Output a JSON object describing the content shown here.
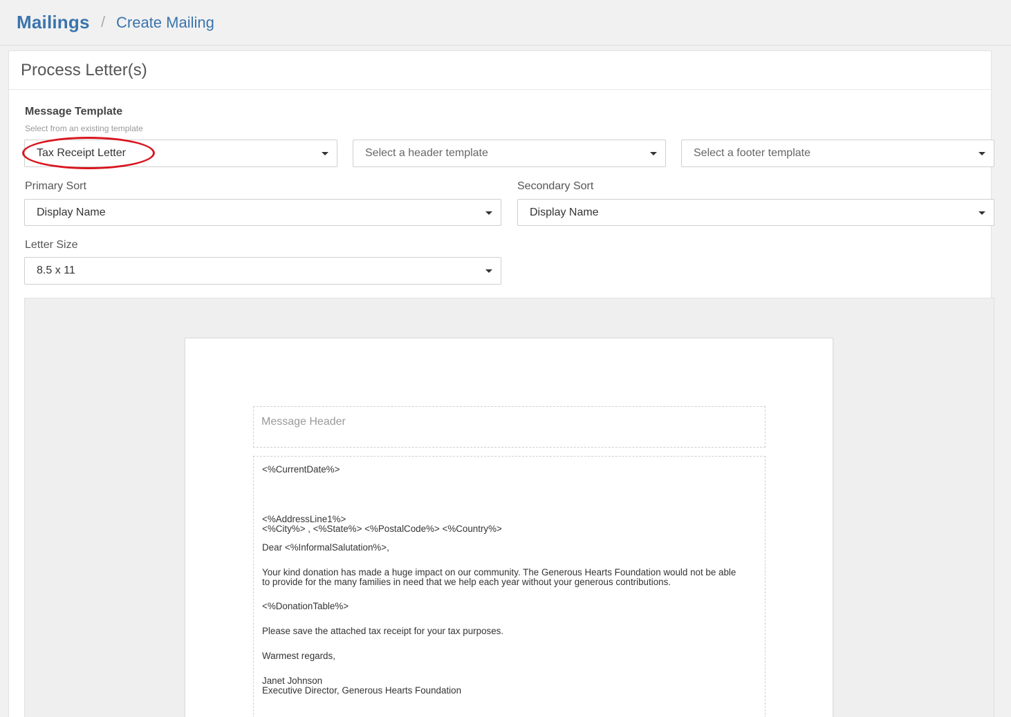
{
  "breadcrumb": {
    "root": "Mailings",
    "separator": "/",
    "current": "Create Mailing"
  },
  "card": {
    "title": "Process Letter(s)"
  },
  "message_template": {
    "label": "Message Template",
    "help": "Select from an existing template",
    "selected": "Tax Receipt Letter",
    "header_placeholder": "Select a header template",
    "footer_placeholder": "Select a footer template"
  },
  "primary_sort": {
    "label": "Primary Sort",
    "selected": "Display Name"
  },
  "secondary_sort": {
    "label": "Secondary Sort",
    "selected": "Display Name"
  },
  "letter_size": {
    "label": "Letter Size",
    "selected": "8.5 x 11"
  },
  "preview": {
    "header_placeholder": "Message Header",
    "body_lines": [
      "<%CurrentDate%>",
      "<%AddressLine1%>",
      "<%City%> , <%State%>  <%PostalCode%>  <%Country%>",
      "Dear <%InformalSalutation%>,",
      "Your kind donation has made a huge impact on our community. The Generous Hearts Foundation would not be able",
      "to provide for the many families in need that we help each year without your generous contributions.",
      "<%DonationTable%>",
      "Please save the attached tax receipt for your tax purposes.",
      "Warmest regards,",
      "Janet Johnson",
      "Executive Director, Generous Hearts Foundation"
    ]
  },
  "colors": {
    "accent": "#3a74ad",
    "highlight": "#d9151f"
  },
  "icons": {
    "dropdown": "caret-down-icon"
  }
}
